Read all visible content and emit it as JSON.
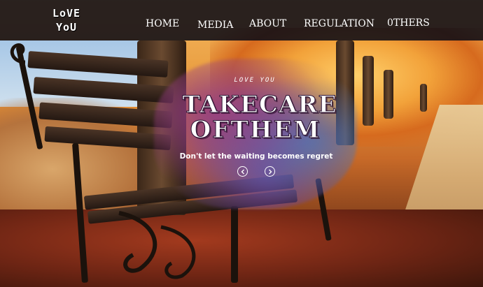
{
  "logo": {
    "line1": "LoVE",
    "line2": "YoU"
  },
  "nav": {
    "items": [
      {
        "label": "HOME"
      },
      {
        "label": "MEDIA"
      },
      {
        "label": "ABOUT"
      },
      {
        "label": "REGULATION"
      },
      {
        "label": "0THERS"
      }
    ]
  },
  "hero": {
    "kicker": "LOVE YOU",
    "title_line1": "TAKECARE",
    "title_line2": "OFTHEM",
    "tagline": "Don't let the waiting becomes regret",
    "prev_icon": "chevron-left-icon",
    "next_icon": "chevron-right-icon"
  },
  "colors": {
    "nav_bg": "#0e0c16",
    "splash_purple": "#96408a",
    "splash_blue": "#4678be"
  }
}
